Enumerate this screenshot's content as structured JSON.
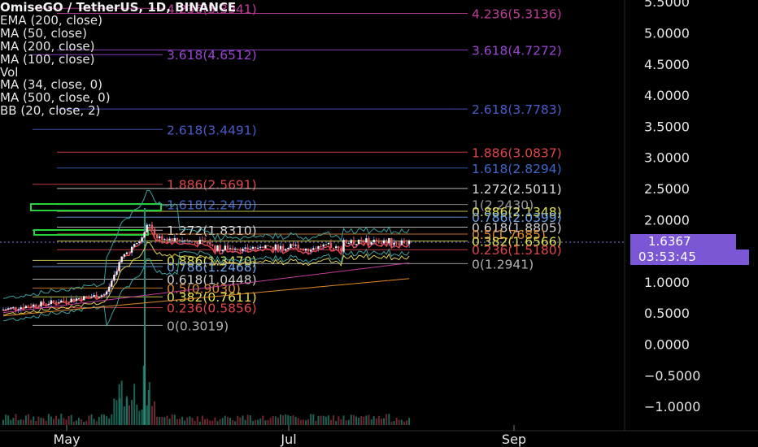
{
  "symbol": "OmiseGO / TetherUS, 1D, BINANCE",
  "indicators": [
    "EMA (200, close)",
    "MA (50, close)",
    "MA (200, close)",
    "MA (100, close)",
    "Vol",
    "MA (34, close, 0)",
    "MA (500, close, 0)",
    "BB (20, close, 2)"
  ],
  "price_tag": "1.6367",
  "countdown": "03:53:45",
  "colors": {
    "background": "#000000",
    "up": "#5b7be0",
    "down": "#e05a66",
    "accent": "#7b57d6",
    "marker_box": "#27d13a"
  },
  "chart_data": {
    "type": "candlestick",
    "y_axis_ticks": [
      "5.5000",
      "5.0000",
      "4.5000",
      "4.0000",
      "3.5000",
      "3.0000",
      "2.5000",
      "2.0000",
      "1.5000",
      "1.0000",
      "0.5000",
      "0.0000",
      "−0.5000",
      "−1.0000"
    ],
    "x_axis_ticks": [
      "May",
      "Jul",
      "Sep"
    ],
    "fib_levels": [
      {
        "label": "4.236(5.3941)",
        "value": 5.3941,
        "color": "#c03c9a"
      },
      {
        "label": "3.618(4.6512)",
        "value": 4.6512,
        "color": "#9b45d6"
      },
      {
        "label": "2.618(3.4491)",
        "value": 3.4491,
        "color": "#4a5bc8"
      },
      {
        "label": "1.886(2.5691)",
        "value": 2.5691,
        "color": "#e0454b"
      },
      {
        "label": "1.618(2.2470)",
        "value": 2.247,
        "color": "#3f67c9"
      },
      {
        "label": "1.272(1.8310)",
        "value": 1.831,
        "color": "#d8d8d8"
      },
      {
        "label": "0.886(1.3470)",
        "value": 1.347,
        "color": "#e0e053"
      },
      {
        "label": "0.786(1.2468)",
        "value": 1.2468,
        "color": "#6ea3e8"
      },
      {
        "label": "0.618(1.0448)",
        "value": 1.0448,
        "color": "#cfcfcf"
      },
      {
        "label": "0.5(0.9030)",
        "value": 0.903,
        "color": "#e08a2a"
      },
      {
        "label": "0.382(0.7611)",
        "value": 0.7611,
        "color": "#e0e053"
      },
      {
        "label": "0.236(0.5856)",
        "value": 0.5856,
        "color": "#e0454b"
      },
      {
        "label": "0(0.3019)",
        "value": 0.3019,
        "color": "#b0b0b0"
      },
      {
        "label": "4.236(5.3136)",
        "value": 5.3136,
        "color": "#c03c9a"
      },
      {
        "label": "3.618(4.7272)",
        "value": 4.7272,
        "color": "#9b45d6"
      },
      {
        "label": "2.618(3.7783)",
        "value": 3.7783,
        "color": "#4a5bc8"
      },
      {
        "label": "1.886(3.0837)",
        "value": 3.0837,
        "color": "#e0454b"
      },
      {
        "label": "1.618(2.8294)",
        "value": 2.8294,
        "color": "#3f67c9"
      },
      {
        "label": "1.272(2.5011)",
        "value": 2.5011,
        "color": "#d8d8d8"
      },
      {
        "label": "1(2.2430)",
        "value": 2.243,
        "color": "#9a9a9a"
      },
      {
        "label": "0.886(2.1348)",
        "value": 2.1348,
        "color": "#e0e053"
      },
      {
        "label": "0.786(2.0399)",
        "value": 2.0399,
        "color": "#6ea3e8"
      },
      {
        "label": "0.618(1.8805)",
        "value": 1.8805,
        "color": "#cfcfcf"
      },
      {
        "label": "0.5(1.7685)",
        "value": 1.7685,
        "color": "#e08a2a"
      },
      {
        "label": "0.382(1.6566)",
        "value": 1.6566,
        "color": "#e0e053"
      },
      {
        "label": "0.236(1.5180)",
        "value": 1.518,
        "color": "#e0454b"
      },
      {
        "label": "0(1.2941)",
        "value": 1.2941,
        "color": "#b0b0b0"
      }
    ]
  }
}
